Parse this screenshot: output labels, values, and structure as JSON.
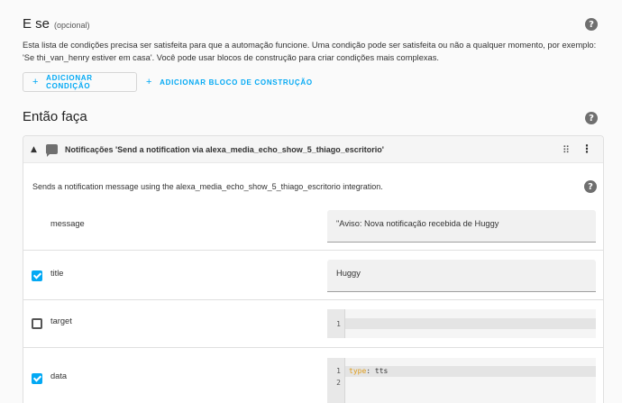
{
  "conditions": {
    "title": "E se",
    "optional": "(opcional)",
    "description": "Esta lista de condições precisa ser satisfeita para que a automação funcione. Uma condição pode ser satisfeita ou não a qualquer momento, por exemplo: 'Se thi_van_henry estiver em casa'. Você pode usar blocos de construção para criar condições mais complexas.",
    "add_condition": "ADICIONAR CONDIÇÃO",
    "add_block": "ADICIONAR BLOCO DE CONSTRUÇÃO",
    "help": "?"
  },
  "actions": {
    "title": "Então faça",
    "help": "?"
  },
  "action_card": {
    "title": "Notificações 'Send a notification via alexa_media_echo_show_5_thiago_escritorio'",
    "description": "Sends a notification message using the alexa_media_echo_show_5_thiago_escritorio integration.",
    "help": "?",
    "fields": {
      "message": {
        "label": "message",
        "value": "\"Aviso: Nova notificação recebida de Huggy"
      },
      "title": {
        "label": "title",
        "value": "Huggy",
        "checked": true
      },
      "target": {
        "label": "target",
        "checked": false,
        "line1": "1"
      },
      "data": {
        "label": "data",
        "checked": true,
        "line1": "1",
        "line2": "2",
        "key": "type",
        "sep": ": ",
        "val": "tts"
      }
    }
  },
  "icons": {
    "plus": "+",
    "chevron": "chevron-up-icon",
    "message": "message-icon",
    "drag": "drag-icon",
    "more": "more-vert-icon"
  },
  "colors": {
    "accent": "#03a9f4",
    "keyword": "#e09c19"
  }
}
